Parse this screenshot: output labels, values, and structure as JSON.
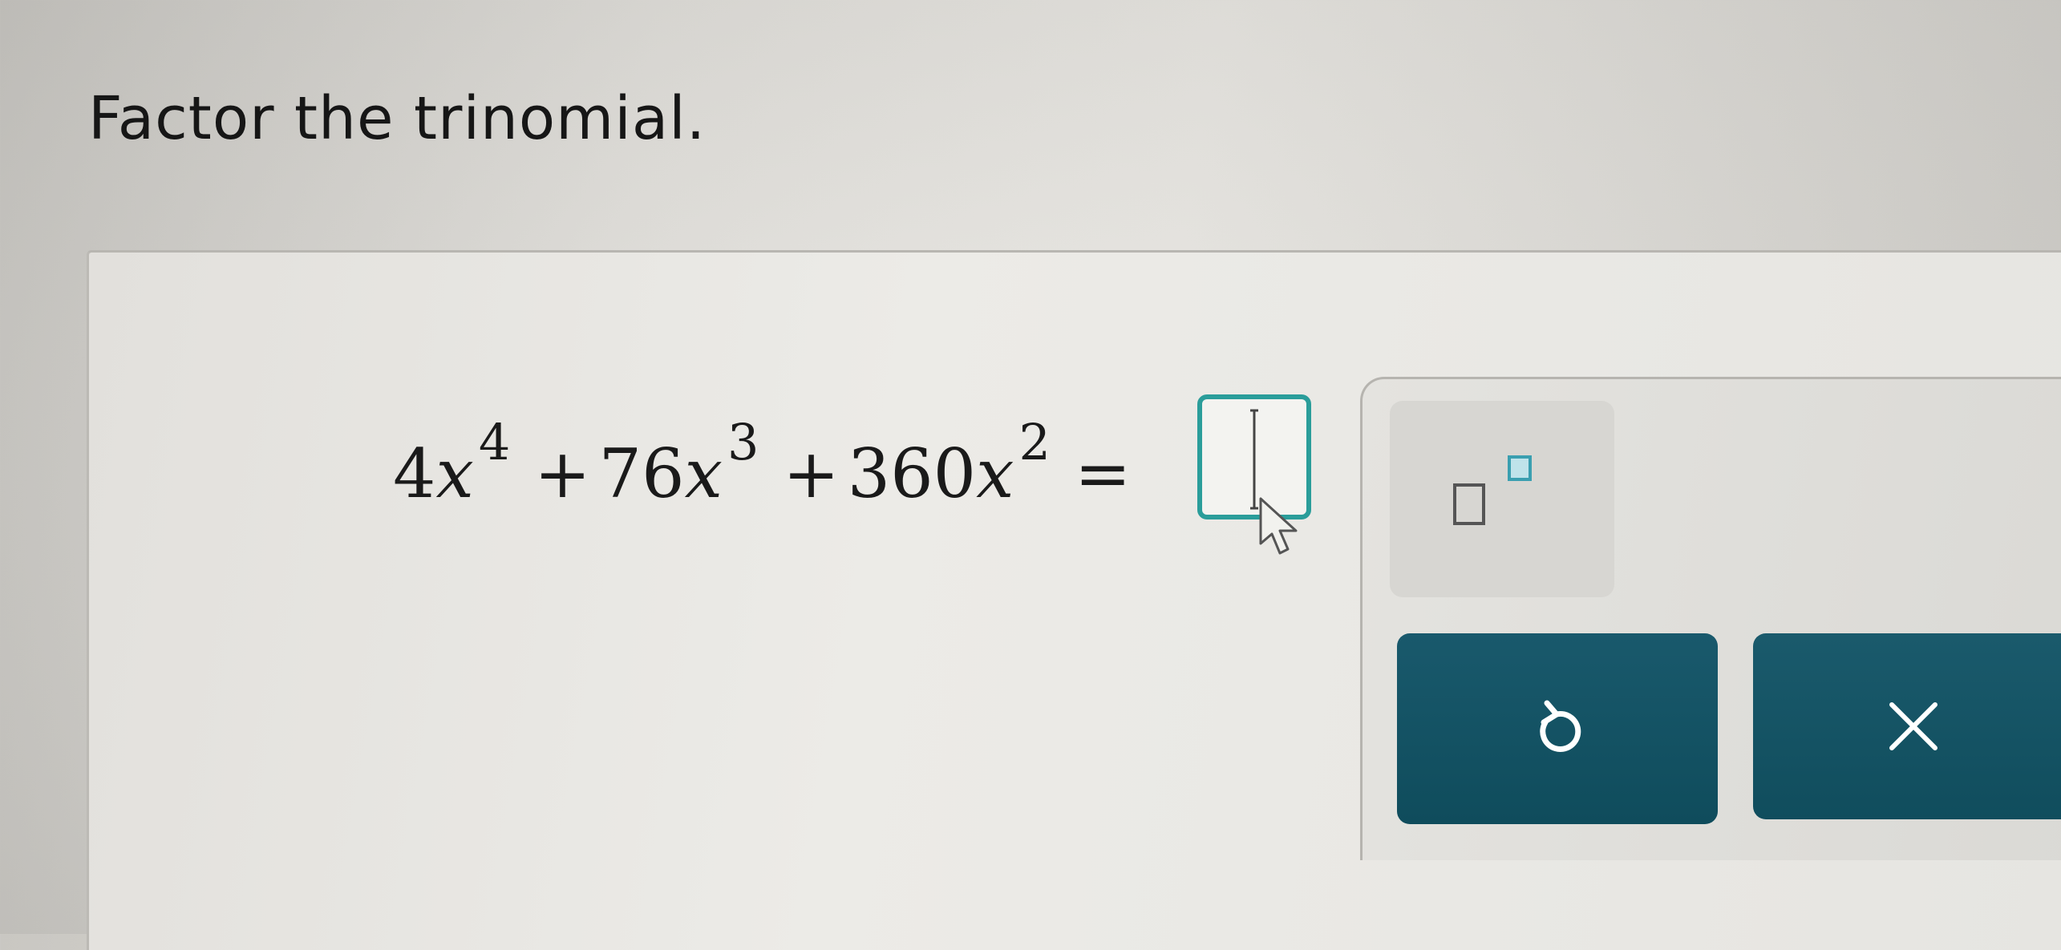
{
  "question": {
    "prompt": "Factor the trinomial."
  },
  "equation": {
    "terms": [
      {
        "coef": "4",
        "var": "x",
        "exp": "4"
      },
      {
        "op": "+",
        "coef": "76",
        "var": "x",
        "exp": "3"
      },
      {
        "op": "+",
        "coef": "360",
        "var": "x",
        "exp": "2"
      }
    ],
    "equals": "=",
    "answer_value": ""
  },
  "toolbox": {
    "exponent_icon": "superscript-template-icon",
    "undo_icon": "undo-icon",
    "clear_icon": "close-icon"
  },
  "colors": {
    "answer_border": "#2a9d9a",
    "button_bg": "#0f4c5c",
    "superscript_accent": "#3a9fb0"
  }
}
